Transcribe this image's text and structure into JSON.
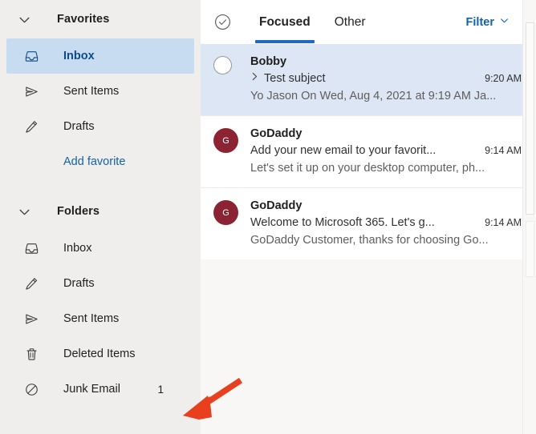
{
  "sidebar": {
    "groups": [
      {
        "title": "Favorites",
        "chevron_icon": "chevron-down-icon",
        "items": [
          {
            "label": "Inbox",
            "icon": "inbox-icon",
            "selected": true,
            "count": ""
          },
          {
            "label": "Sent Items",
            "icon": "send-icon",
            "selected": false,
            "count": ""
          },
          {
            "label": "Drafts",
            "icon": "pencil-icon",
            "selected": false,
            "count": ""
          }
        ],
        "add_link": "Add favorite"
      },
      {
        "title": "Folders",
        "chevron_icon": "chevron-down-icon",
        "items": [
          {
            "label": "Inbox",
            "icon": "inbox-icon",
            "selected": false,
            "count": ""
          },
          {
            "label": "Drafts",
            "icon": "pencil-icon",
            "selected": false,
            "count": ""
          },
          {
            "label": "Sent Items",
            "icon": "send-icon",
            "selected": false,
            "count": ""
          },
          {
            "label": "Deleted Items",
            "icon": "trash-icon",
            "selected": false,
            "count": ""
          },
          {
            "label": "Junk Email",
            "icon": "block-icon",
            "selected": false,
            "count": "1"
          }
        ]
      }
    ]
  },
  "list_header": {
    "select_all_icon": "circle-check-icon",
    "tabs": [
      {
        "label": "Focused",
        "active": true
      },
      {
        "label": "Other",
        "active": false
      }
    ],
    "filter_label": "Filter",
    "filter_chevron_icon": "chevron-down-icon"
  },
  "messages": [
    {
      "sender": "Bobby",
      "subject": "Test subject",
      "preview": "Yo Jason On Wed, Aug 4, 2021 at 9:19 AM Ja...",
      "time": "9:20 AM",
      "selected": true,
      "has_thread_chevron": true,
      "avatar": {
        "type": "circle",
        "initial": "",
        "color": "#ffffff"
      }
    },
    {
      "sender": "GoDaddy",
      "subject": "Add your new email to your favorit...",
      "preview": "Let's set it up on your desktop computer, ph...",
      "time": "9:14 AM",
      "selected": false,
      "has_thread_chevron": false,
      "avatar": {
        "type": "initial",
        "initial": "G",
        "color": "#8b2332"
      }
    },
    {
      "sender": "GoDaddy",
      "subject": "Welcome to Microsoft 365. Let's g...",
      "preview": "GoDaddy Customer, thanks for choosing Go...",
      "time": "9:14 AM",
      "selected": false,
      "has_thread_chevron": false,
      "avatar": {
        "type": "initial",
        "initial": "G",
        "color": "#8b2332"
      }
    }
  ],
  "annotation": {
    "arrow_icon": "red-arrow-icon",
    "color": "#e8401f"
  },
  "colors": {
    "accent": "#0f6cbd",
    "tab_underline": "#2266c6",
    "selected_row": "#c7dcf0",
    "selected_message": "#dce6f4",
    "sidebar_bg": "#efeeed",
    "pane_bg": "#f8f7f6",
    "avatar_godaddy": "#8b2332",
    "annotation_red": "#e8401f"
  }
}
